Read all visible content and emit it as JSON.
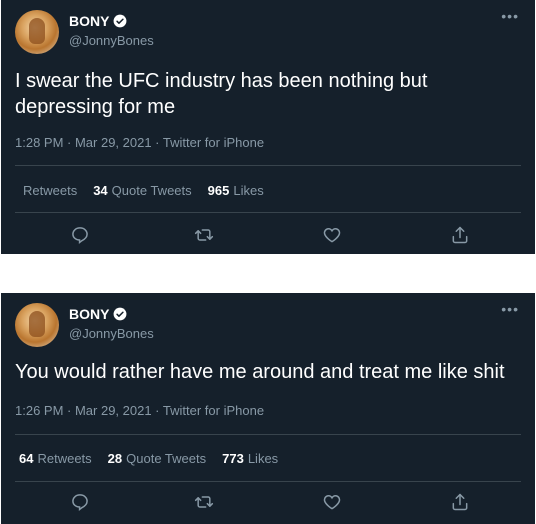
{
  "tweets": [
    {
      "name": "BONY",
      "handle": "@JonnyBones",
      "text": "I swear the UFC industry has been nothing but depressing for me",
      "meta": "1:28 PM · Mar 29, 2021 · Twitter for iPhone",
      "retweets_count": "",
      "retweets_label": "Retweets",
      "quote_count": "34",
      "quote_label": "Quote Tweets",
      "likes_count": "965",
      "likes_label": "Likes"
    },
    {
      "name": "BONY",
      "handle": "@JonnyBones",
      "text": "You would rather have me around and treat me like shit",
      "meta": "1:26 PM · Mar 29, 2021 · Twitter for iPhone",
      "retweets_count": "64",
      "retweets_label": "Retweets",
      "quote_count": "28",
      "quote_label": "Quote Tweets",
      "likes_count": "773",
      "likes_label": "Likes"
    }
  ],
  "icons": {
    "more": "more-icon",
    "verified": "verified-icon",
    "reply": "reply-icon",
    "retweet": "retweet-icon",
    "like": "like-icon",
    "share": "share-icon"
  },
  "colors": {
    "card_bg": "#15202b",
    "muted": "#8899a6",
    "divider": "#38444d",
    "text": "#ffffff",
    "page_bg": "#ffffff"
  }
}
